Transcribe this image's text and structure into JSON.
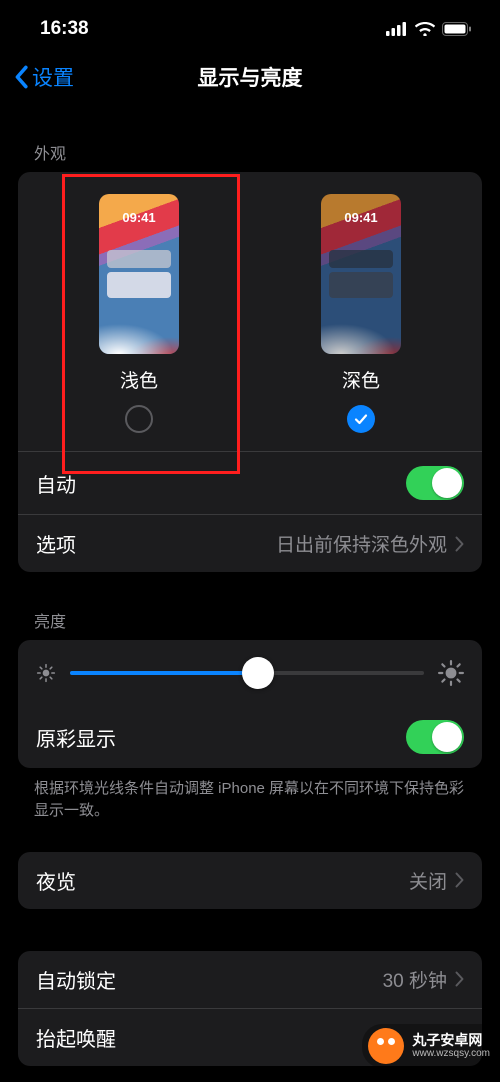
{
  "status": {
    "time": "16:38"
  },
  "nav": {
    "back": "设置",
    "title": "显示与亮度"
  },
  "appearance": {
    "section_label": "外观",
    "preview_time": "09:41",
    "light": {
      "label": "浅色",
      "selected": false
    },
    "dark": {
      "label": "深色",
      "selected": true
    },
    "auto_label": "自动",
    "options_label": "选项",
    "options_value": "日出前保持深色外观"
  },
  "brightness": {
    "section_label": "亮度",
    "true_tone_label": "原彩显示",
    "true_tone_note": "根据环境光线条件自动调整 iPhone 屏幕以在不同环境下保持色彩显示一致。",
    "slider_percent": 53
  },
  "night_shift": {
    "label": "夜览",
    "value": "关闭"
  },
  "auto_lock": {
    "label": "自动锁定",
    "value": "30 秒钟"
  },
  "raise": {
    "label": "抬起唤醒"
  },
  "watermark": {
    "name": "丸子安卓网",
    "url": "www.wzsqsy.com"
  }
}
